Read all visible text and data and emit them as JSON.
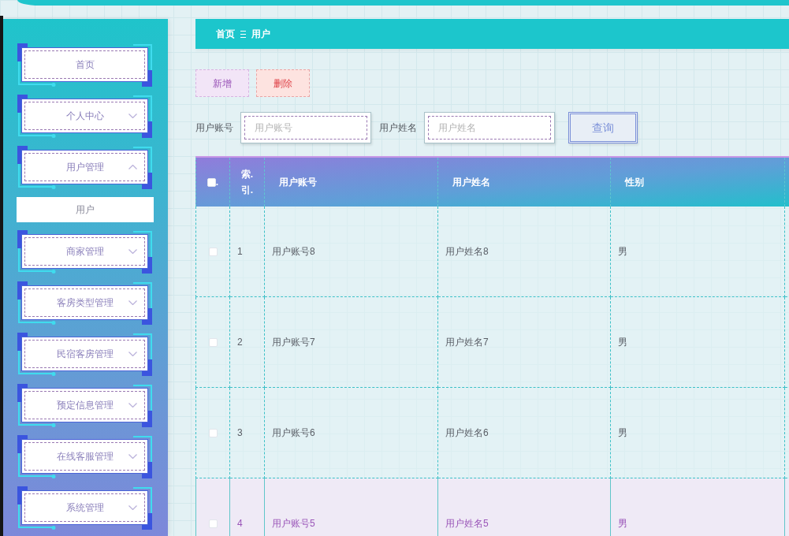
{
  "sidebar": {
    "items": [
      {
        "label": "首页",
        "kind": "link"
      },
      {
        "label": "个人中心",
        "kind": "menu",
        "expanded": false
      },
      {
        "label": "用户管理",
        "kind": "menu",
        "expanded": true,
        "children": [
          {
            "label": "用户"
          }
        ]
      },
      {
        "label": "商家管理",
        "kind": "menu",
        "expanded": false
      },
      {
        "label": "客房类型管理",
        "kind": "menu",
        "expanded": false
      },
      {
        "label": "民宿客房管理",
        "kind": "menu",
        "expanded": false
      },
      {
        "label": "预定信息管理",
        "kind": "menu",
        "expanded": false
      },
      {
        "label": "在线客服管理",
        "kind": "menu",
        "expanded": false
      },
      {
        "label": "系统管理",
        "kind": "menu",
        "expanded": false
      }
    ]
  },
  "breadcrumb": [
    "首页",
    "用户"
  ],
  "actions": [
    {
      "label": "新增",
      "kind": "add"
    },
    {
      "label": "删除",
      "kind": "delete"
    }
  ],
  "search": {
    "fields": [
      {
        "label": "用户账号",
        "placeholder": "用户账号"
      },
      {
        "label": "用户姓名",
        "placeholder": "用户姓名"
      }
    ],
    "button": "查询"
  },
  "table": {
    "select_all": {
      "checked": false,
      "suffix": "."
    },
    "columns": [
      "索.引.",
      "用户账号",
      "用户姓名",
      "性别"
    ],
    "rows": [
      {
        "checked": false,
        "highlighted": false,
        "cells": [
          "1",
          "用户账号8",
          "用户姓名8",
          "男"
        ]
      },
      {
        "checked": false,
        "highlighted": false,
        "cells": [
          "2",
          "用户账号7",
          "用户姓名7",
          "男"
        ]
      },
      {
        "checked": false,
        "highlighted": false,
        "cells": [
          "3",
          "用户账号6",
          "用户姓名6",
          "男"
        ]
      },
      {
        "checked": false,
        "highlighted": true,
        "cells": [
          "4",
          "用户账号5",
          "用户姓名5",
          "男"
        ]
      }
    ]
  }
}
